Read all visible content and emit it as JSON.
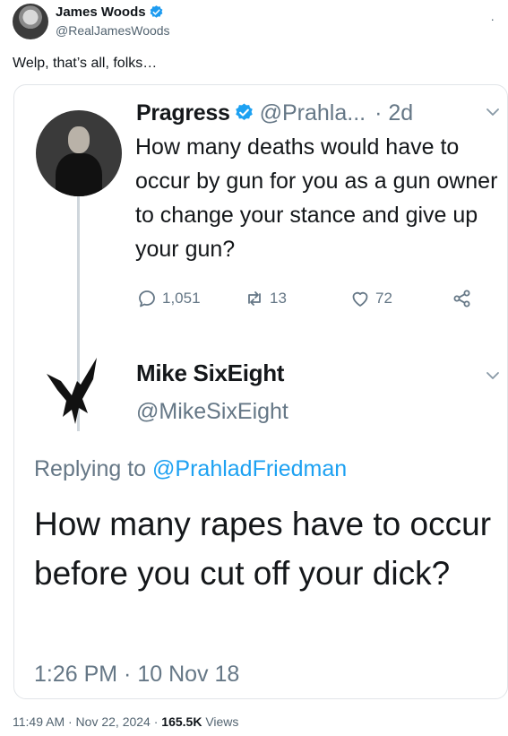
{
  "colors": {
    "verified_blue": "#1d9bf0",
    "link_blue": "#1da1f2",
    "secondary_text": "#536471",
    "embed_border": "#e1e4e8"
  },
  "post": {
    "author_name": "James Woods",
    "author_handle": "@RealJamesWoods",
    "more_icon": "more-icon",
    "text": "Welp, that’s all, folks…",
    "timestamp": "11:49 AM · Nov 22, 2024 · ",
    "views_count": "165.5K",
    "views_label": " Views"
  },
  "screenshot": {
    "quoted": {
      "author_name": "Pragress",
      "author_handle": "@Prahla...",
      "time_ago": "· 2d",
      "text": "How many deaths would have to occur by gun for you as a gun owner to change your stance and give up your gun?",
      "actions": {
        "replies": "1,051",
        "retweets": "13",
        "likes": "72"
      }
    },
    "reply": {
      "author_name": "Mike SixEight",
      "author_handle": "@MikeSixEight",
      "replying_to_label": "Replying to ",
      "replying_to_handle": "@PrahladFriedman",
      "text": "How many rapes have to occur before you cut off your dick?",
      "timestamp": "1:26 PM · 10 Nov 18"
    }
  }
}
